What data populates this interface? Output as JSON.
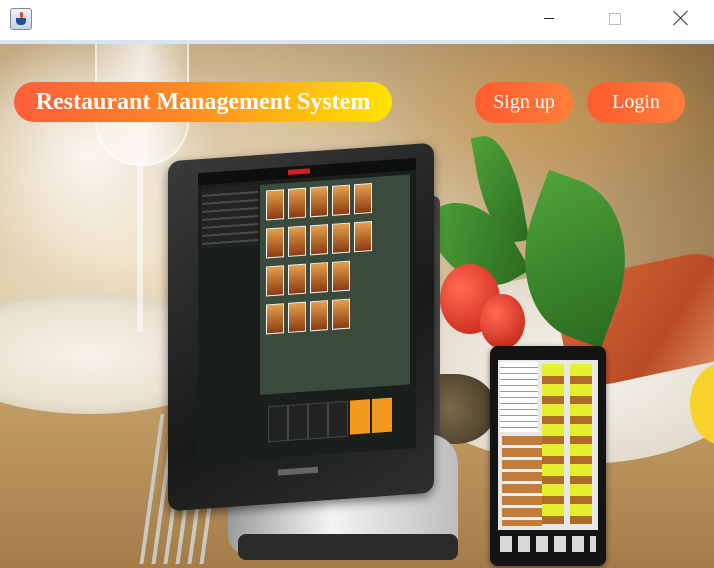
{
  "window": {
    "app_icon": "java-cup-icon",
    "controls": [
      "minimize-icon",
      "maximize-icon",
      "close-icon"
    ]
  },
  "header": {
    "title": "Restaurant Management System",
    "signup_label": "Sign up",
    "login_label": "Login"
  },
  "colors": {
    "title_gradient_start": "#ff5e3a",
    "title_gradient_end": "#ffe400",
    "button_orange": "#ff6a30",
    "text": "#ffffff"
  }
}
